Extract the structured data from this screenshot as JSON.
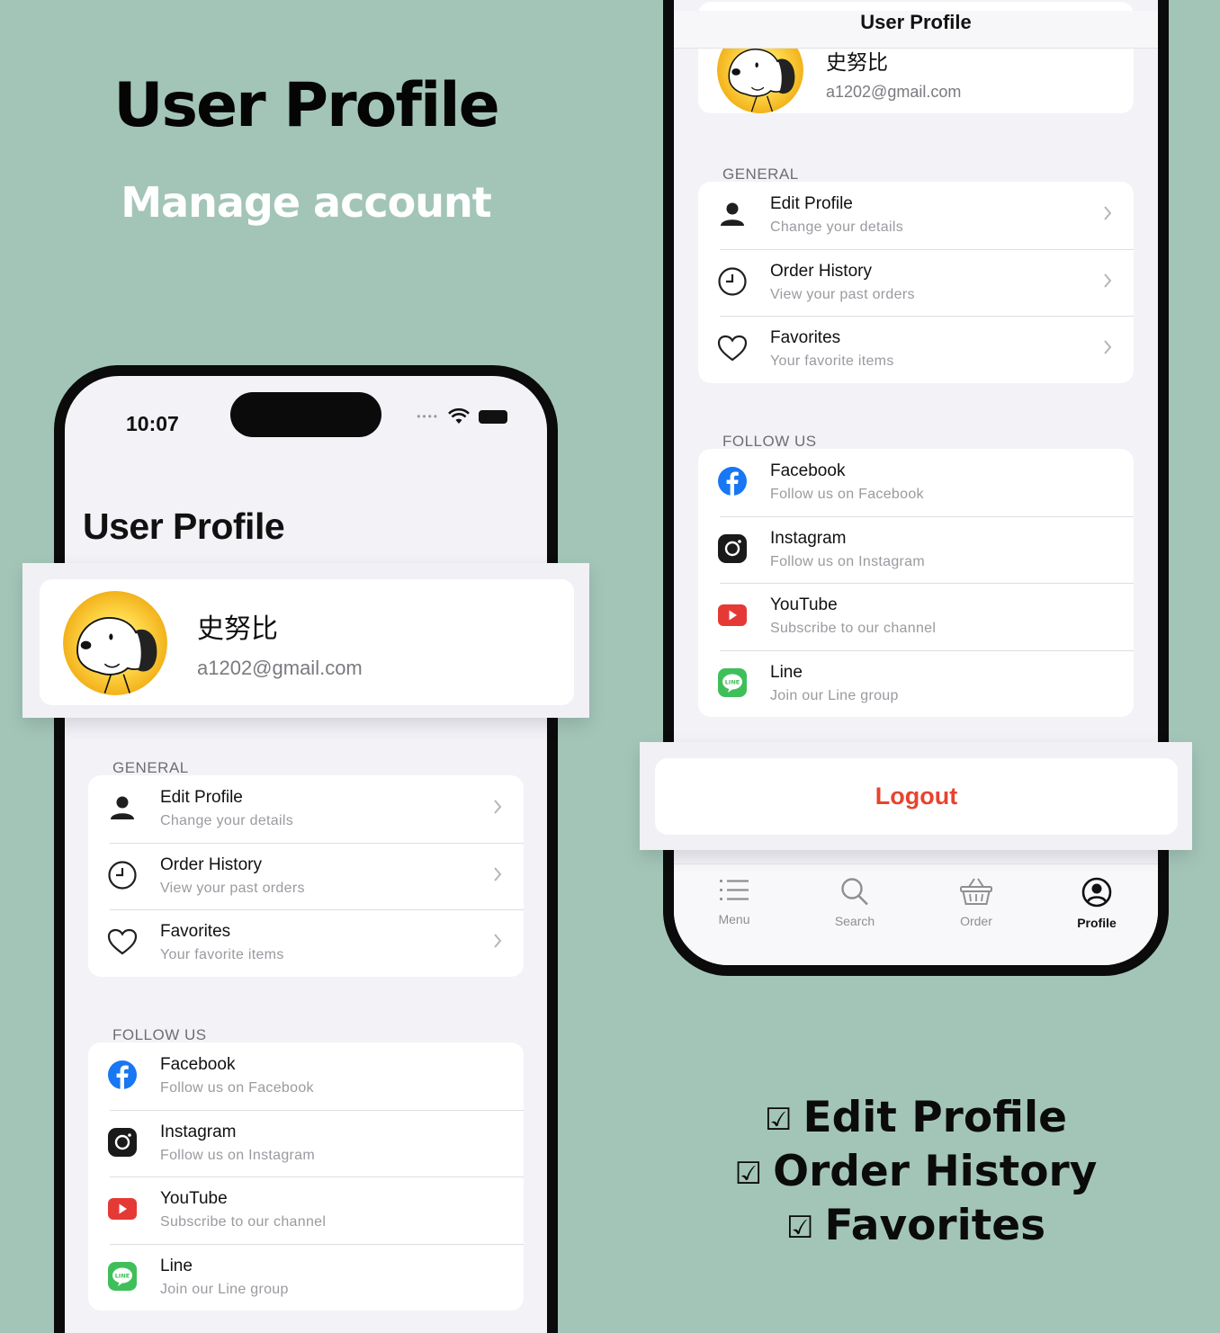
{
  "hero": {
    "title": "User Profile",
    "subtitle": "Manage account"
  },
  "status": {
    "time": "10:07"
  },
  "screen": {
    "title": "User Profile"
  },
  "profile": {
    "name": "史努比",
    "email": "a1202@gmail.com"
  },
  "sections": {
    "general": "GENERAL",
    "follow": "FOLLOW US"
  },
  "general_items": [
    {
      "title": "Edit Profile",
      "subtitle": "Change your details",
      "icon": "person-icon"
    },
    {
      "title": "Order History",
      "subtitle": "View your past orders",
      "icon": "clock-icon"
    },
    {
      "title": "Favorites",
      "subtitle": "Your favorite items",
      "icon": "heart-icon"
    }
  ],
  "follow_items": [
    {
      "title": "Facebook",
      "subtitle": "Follow us on Facebook",
      "icon": "facebook-icon"
    },
    {
      "title": "Instagram",
      "subtitle": "Follow us on Instagram",
      "icon": "instagram-icon"
    },
    {
      "title": "YouTube",
      "subtitle": "Subscribe to our channel",
      "icon": "youtube-icon"
    },
    {
      "title": "Line",
      "subtitle": "Join our Line group",
      "icon": "line-icon"
    }
  ],
  "logout": "Logout",
  "tabs": [
    {
      "label": "Menu",
      "icon": "menu-list-icon"
    },
    {
      "label": "Search",
      "icon": "search-icon"
    },
    {
      "label": "Order",
      "icon": "basket-icon"
    },
    {
      "label": "Profile",
      "icon": "profile-circle-icon"
    }
  ],
  "checklist": [
    "Edit Profile",
    "Order History",
    "Favorites"
  ],
  "colors": {
    "background": "#a3c5b8",
    "logout": "#e8432e",
    "facebook": "#1877f2",
    "youtube": "#e53935",
    "line": "#3fbf5a"
  }
}
